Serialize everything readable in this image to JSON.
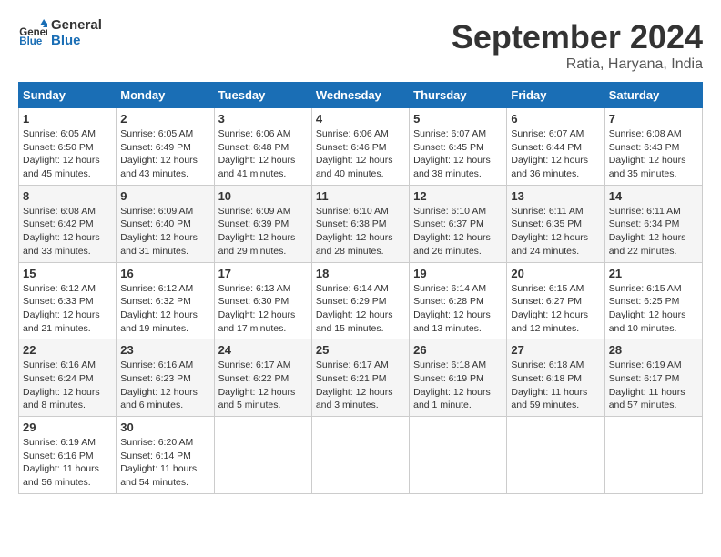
{
  "header": {
    "logo_line1": "General",
    "logo_line2": "Blue",
    "month_title": "September 2024",
    "location": "Ratia, Haryana, India"
  },
  "weekdays": [
    "Sunday",
    "Monday",
    "Tuesday",
    "Wednesday",
    "Thursday",
    "Friday",
    "Saturday"
  ],
  "weeks": [
    [
      {
        "day": "1",
        "rise": "6:05 AM",
        "set": "6:50 PM",
        "daylight": "12 hours and 45 minutes."
      },
      {
        "day": "2",
        "rise": "6:05 AM",
        "set": "6:49 PM",
        "daylight": "12 hours and 43 minutes."
      },
      {
        "day": "3",
        "rise": "6:06 AM",
        "set": "6:48 PM",
        "daylight": "12 hours and 41 minutes."
      },
      {
        "day": "4",
        "rise": "6:06 AM",
        "set": "6:46 PM",
        "daylight": "12 hours and 40 minutes."
      },
      {
        "day": "5",
        "rise": "6:07 AM",
        "set": "6:45 PM",
        "daylight": "12 hours and 38 minutes."
      },
      {
        "day": "6",
        "rise": "6:07 AM",
        "set": "6:44 PM",
        "daylight": "12 hours and 36 minutes."
      },
      {
        "day": "7",
        "rise": "6:08 AM",
        "set": "6:43 PM",
        "daylight": "12 hours and 35 minutes."
      }
    ],
    [
      {
        "day": "8",
        "rise": "6:08 AM",
        "set": "6:42 PM",
        "daylight": "12 hours and 33 minutes."
      },
      {
        "day": "9",
        "rise": "6:09 AM",
        "set": "6:40 PM",
        "daylight": "12 hours and 31 minutes."
      },
      {
        "day": "10",
        "rise": "6:09 AM",
        "set": "6:39 PM",
        "daylight": "12 hours and 29 minutes."
      },
      {
        "day": "11",
        "rise": "6:10 AM",
        "set": "6:38 PM",
        "daylight": "12 hours and 28 minutes."
      },
      {
        "day": "12",
        "rise": "6:10 AM",
        "set": "6:37 PM",
        "daylight": "12 hours and 26 minutes."
      },
      {
        "day": "13",
        "rise": "6:11 AM",
        "set": "6:35 PM",
        "daylight": "12 hours and 24 minutes."
      },
      {
        "day": "14",
        "rise": "6:11 AM",
        "set": "6:34 PM",
        "daylight": "12 hours and 22 minutes."
      }
    ],
    [
      {
        "day": "15",
        "rise": "6:12 AM",
        "set": "6:33 PM",
        "daylight": "12 hours and 21 minutes."
      },
      {
        "day": "16",
        "rise": "6:12 AM",
        "set": "6:32 PM",
        "daylight": "12 hours and 19 minutes."
      },
      {
        "day": "17",
        "rise": "6:13 AM",
        "set": "6:30 PM",
        "daylight": "12 hours and 17 minutes."
      },
      {
        "day": "18",
        "rise": "6:14 AM",
        "set": "6:29 PM",
        "daylight": "12 hours and 15 minutes."
      },
      {
        "day": "19",
        "rise": "6:14 AM",
        "set": "6:28 PM",
        "daylight": "12 hours and 13 minutes."
      },
      {
        "day": "20",
        "rise": "6:15 AM",
        "set": "6:27 PM",
        "daylight": "12 hours and 12 minutes."
      },
      {
        "day": "21",
        "rise": "6:15 AM",
        "set": "6:25 PM",
        "daylight": "12 hours and 10 minutes."
      }
    ],
    [
      {
        "day": "22",
        "rise": "6:16 AM",
        "set": "6:24 PM",
        "daylight": "12 hours and 8 minutes."
      },
      {
        "day": "23",
        "rise": "6:16 AM",
        "set": "6:23 PM",
        "daylight": "12 hours and 6 minutes."
      },
      {
        "day": "24",
        "rise": "6:17 AM",
        "set": "6:22 PM",
        "daylight": "12 hours and 5 minutes."
      },
      {
        "day": "25",
        "rise": "6:17 AM",
        "set": "6:21 PM",
        "daylight": "12 hours and 3 minutes."
      },
      {
        "day": "26",
        "rise": "6:18 AM",
        "set": "6:19 PM",
        "daylight": "12 hours and 1 minute."
      },
      {
        "day": "27",
        "rise": "6:18 AM",
        "set": "6:18 PM",
        "daylight": "11 hours and 59 minutes."
      },
      {
        "day": "28",
        "rise": "6:19 AM",
        "set": "6:17 PM",
        "daylight": "11 hours and 57 minutes."
      }
    ],
    [
      {
        "day": "29",
        "rise": "6:19 AM",
        "set": "6:16 PM",
        "daylight": "11 hours and 56 minutes."
      },
      {
        "day": "30",
        "rise": "6:20 AM",
        "set": "6:14 PM",
        "daylight": "11 hours and 54 minutes."
      },
      null,
      null,
      null,
      null,
      null
    ]
  ],
  "labels": {
    "sunrise": "Sunrise:",
    "sunset": "Sunset:",
    "daylight": "Daylight:"
  }
}
